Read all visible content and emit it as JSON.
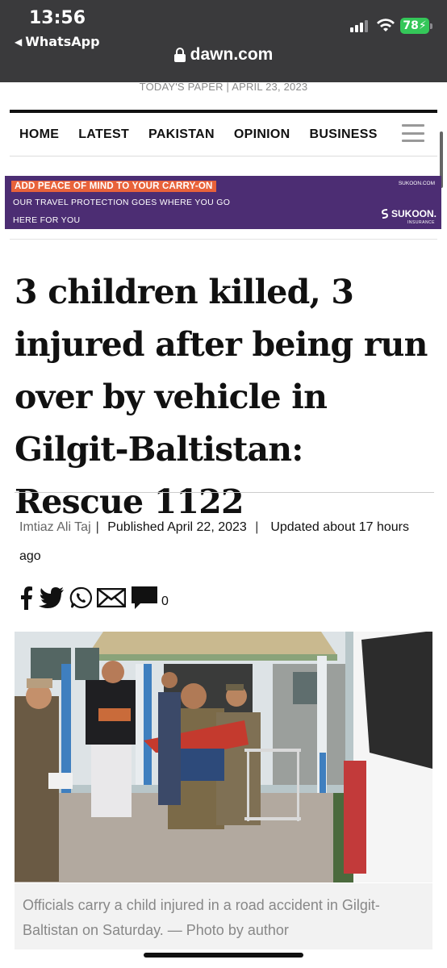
{
  "status_bar": {
    "time": "13:56",
    "back_app": "WhatsApp",
    "battery": "78"
  },
  "address_bar": {
    "domain": "dawn.com"
  },
  "header": {
    "todays_paper": "TODAY'S PAPER | APRIL 23, 2023"
  },
  "nav": {
    "items": [
      "HOME",
      "LATEST",
      "PAKISTAN",
      "OPINION",
      "BUSINESS"
    ]
  },
  "ad": {
    "line1": "ADD PEACE OF MIND TO YOUR CARRY-ON",
    "line2": "OUR TRAVEL PROTECTION GOES WHERE YOU GO",
    "line3": "HERE FOR YOU",
    "site": "SUKOON.COM",
    "brand": "SUKOON.",
    "brand_sub": "INSURANCE",
    "bg_color": "#4c2d73",
    "accent_color": "#e8623a"
  },
  "article": {
    "headline": "3 children killed, 3 injured after being run over by vehicle in Gilgit-Baltistan: Rescue 1122",
    "author": "Imtiaz Ali Taj",
    "published": "Published April 22, 2023",
    "updated": "Updated about 17 hours ago",
    "comment_count": "0",
    "caption": "Officials carry a child injured in a road accident in Gilgit-Baltistan on Saturday. — Photo by author"
  },
  "icons": {
    "share": [
      "facebook-icon",
      "twitter-icon",
      "whatsapp-icon",
      "email-icon",
      "comment-icon"
    ]
  }
}
